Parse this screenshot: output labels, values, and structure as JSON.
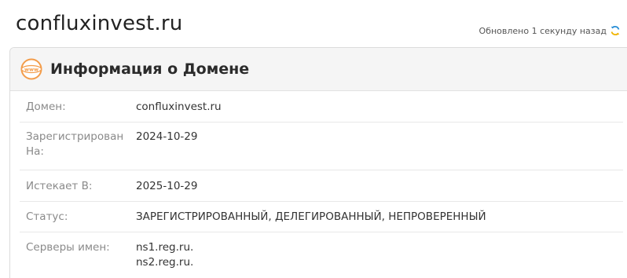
{
  "site": {
    "title": "confluxinvest.ru"
  },
  "updated": {
    "text": "Обновлено 1 секунду назад",
    "icon": "refresh-icon"
  },
  "panel": {
    "icon": "www-icon",
    "title": "Информация о Домене",
    "rows": [
      {
        "label": "Домен:",
        "value": "confluxinvest.ru"
      },
      {
        "label": "Зарегистрирован На:",
        "value": "2024-10-29"
      },
      {
        "label": "Истекает В:",
        "value": "2025-10-29"
      },
      {
        "label": "Статус:",
        "value": "ЗАРЕГИСТРИРОВАННЫЙ, ДЕЛЕГИРОВАННЫЙ, НЕПРОВЕРЕННЫЙ"
      },
      {
        "label": "Серверы имен:",
        "values": [
          "ns1.reg.ru.",
          "ns2.reg.ru."
        ]
      }
    ]
  },
  "colors": {
    "accent": "#f39c4a",
    "refresh": "#2a8fd6"
  }
}
